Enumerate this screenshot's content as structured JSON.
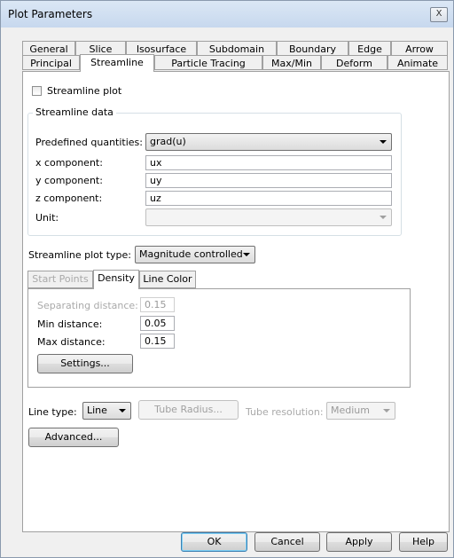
{
  "window": {
    "title": "Plot Parameters",
    "close_label": "X"
  },
  "tabs_row1": [
    "General",
    "Slice",
    "Isosurface",
    "Subdomain",
    "Boundary",
    "Edge",
    "Arrow"
  ],
  "tabs_row2": [
    "Principal",
    "Streamline",
    "Particle Tracing",
    "Max/Min",
    "Deform",
    "Animate"
  ],
  "active_tab": "Streamline",
  "streamline": {
    "plot_checkbox_label": "Streamline plot",
    "plot_checked": false,
    "data_group_label": "Streamline data",
    "predefined_label": "Predefined quantities:",
    "predefined_value": "grad(u)",
    "x_label": "x component:",
    "x_value": "ux",
    "y_label": "y component:",
    "y_value": "uy",
    "z_label": "z component:",
    "z_value": "uz",
    "unit_label": "Unit:",
    "unit_value": "",
    "plot_type_label": "Streamline plot type:",
    "plot_type_value": "Magnitude controlled"
  },
  "inner_tabs": [
    "Start Points",
    "Density",
    "Line Color"
  ],
  "inner_active_tab": "Density",
  "density": {
    "sep_label": "Separating distance:",
    "sep_value": "0.15",
    "min_label": "Min distance:",
    "min_value": "0.05",
    "max_label": "Max distance:",
    "max_value": "0.15",
    "settings_label": "Settings..."
  },
  "line": {
    "type_label": "Line type:",
    "type_value": "Line",
    "tube_radius_label": "Tube Radius...",
    "tube_res_label": "Tube resolution:",
    "tube_res_value": "Medium"
  },
  "advanced_label": "Advanced...",
  "footer": {
    "ok": "OK",
    "cancel": "Cancel",
    "apply": "Apply",
    "help": "Help"
  }
}
